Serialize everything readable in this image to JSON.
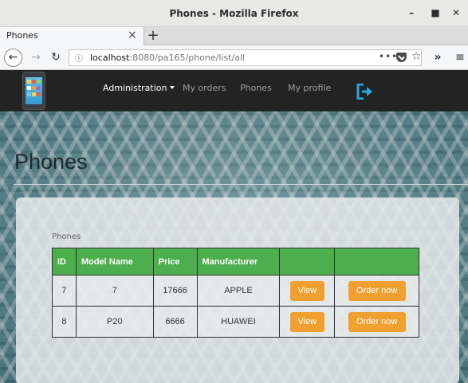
{
  "window": {
    "title": "Phones - Mozilla Firefox"
  },
  "tab": {
    "label": "Phones"
  },
  "address": {
    "host": "localhost",
    "path": ":8080/pa165/phone/list/all"
  },
  "site_nav": {
    "items": [
      {
        "label": "Administration"
      },
      {
        "label": "My orders"
      },
      {
        "label": "Phones"
      },
      {
        "label": "My profile"
      }
    ]
  },
  "page": {
    "title": "Phones",
    "table_caption": "Phones"
  },
  "table": {
    "headers": [
      "ID",
      "Model Name",
      "Price",
      "Manufacturer",
      "",
      ""
    ],
    "rows": [
      {
        "id": "7",
        "model": "7",
        "price": "17666",
        "manufacturer": "APPLE",
        "view_label": "View",
        "order_label": "Order now"
      },
      {
        "id": "8",
        "model": "P20",
        "price": "6666",
        "manufacturer": "HUAWEI",
        "view_label": "View",
        "order_label": "Order now"
      }
    ]
  },
  "colors": {
    "table_header": "#4cae4c",
    "button": "#f0a030",
    "nav_bg": "#232323",
    "logout_icon": "#2aa6d8"
  },
  "icons": [
    "minimize-icon",
    "maximize-icon",
    "close-icon",
    "tab-close-icon",
    "new-tab-icon",
    "back-icon",
    "forward-icon",
    "reload-icon",
    "info-icon",
    "page-actions-icon",
    "pocket-icon",
    "bookmark-star-icon",
    "overflow-icon",
    "menu-icon",
    "phone-logo-icon",
    "logout-icon"
  ]
}
